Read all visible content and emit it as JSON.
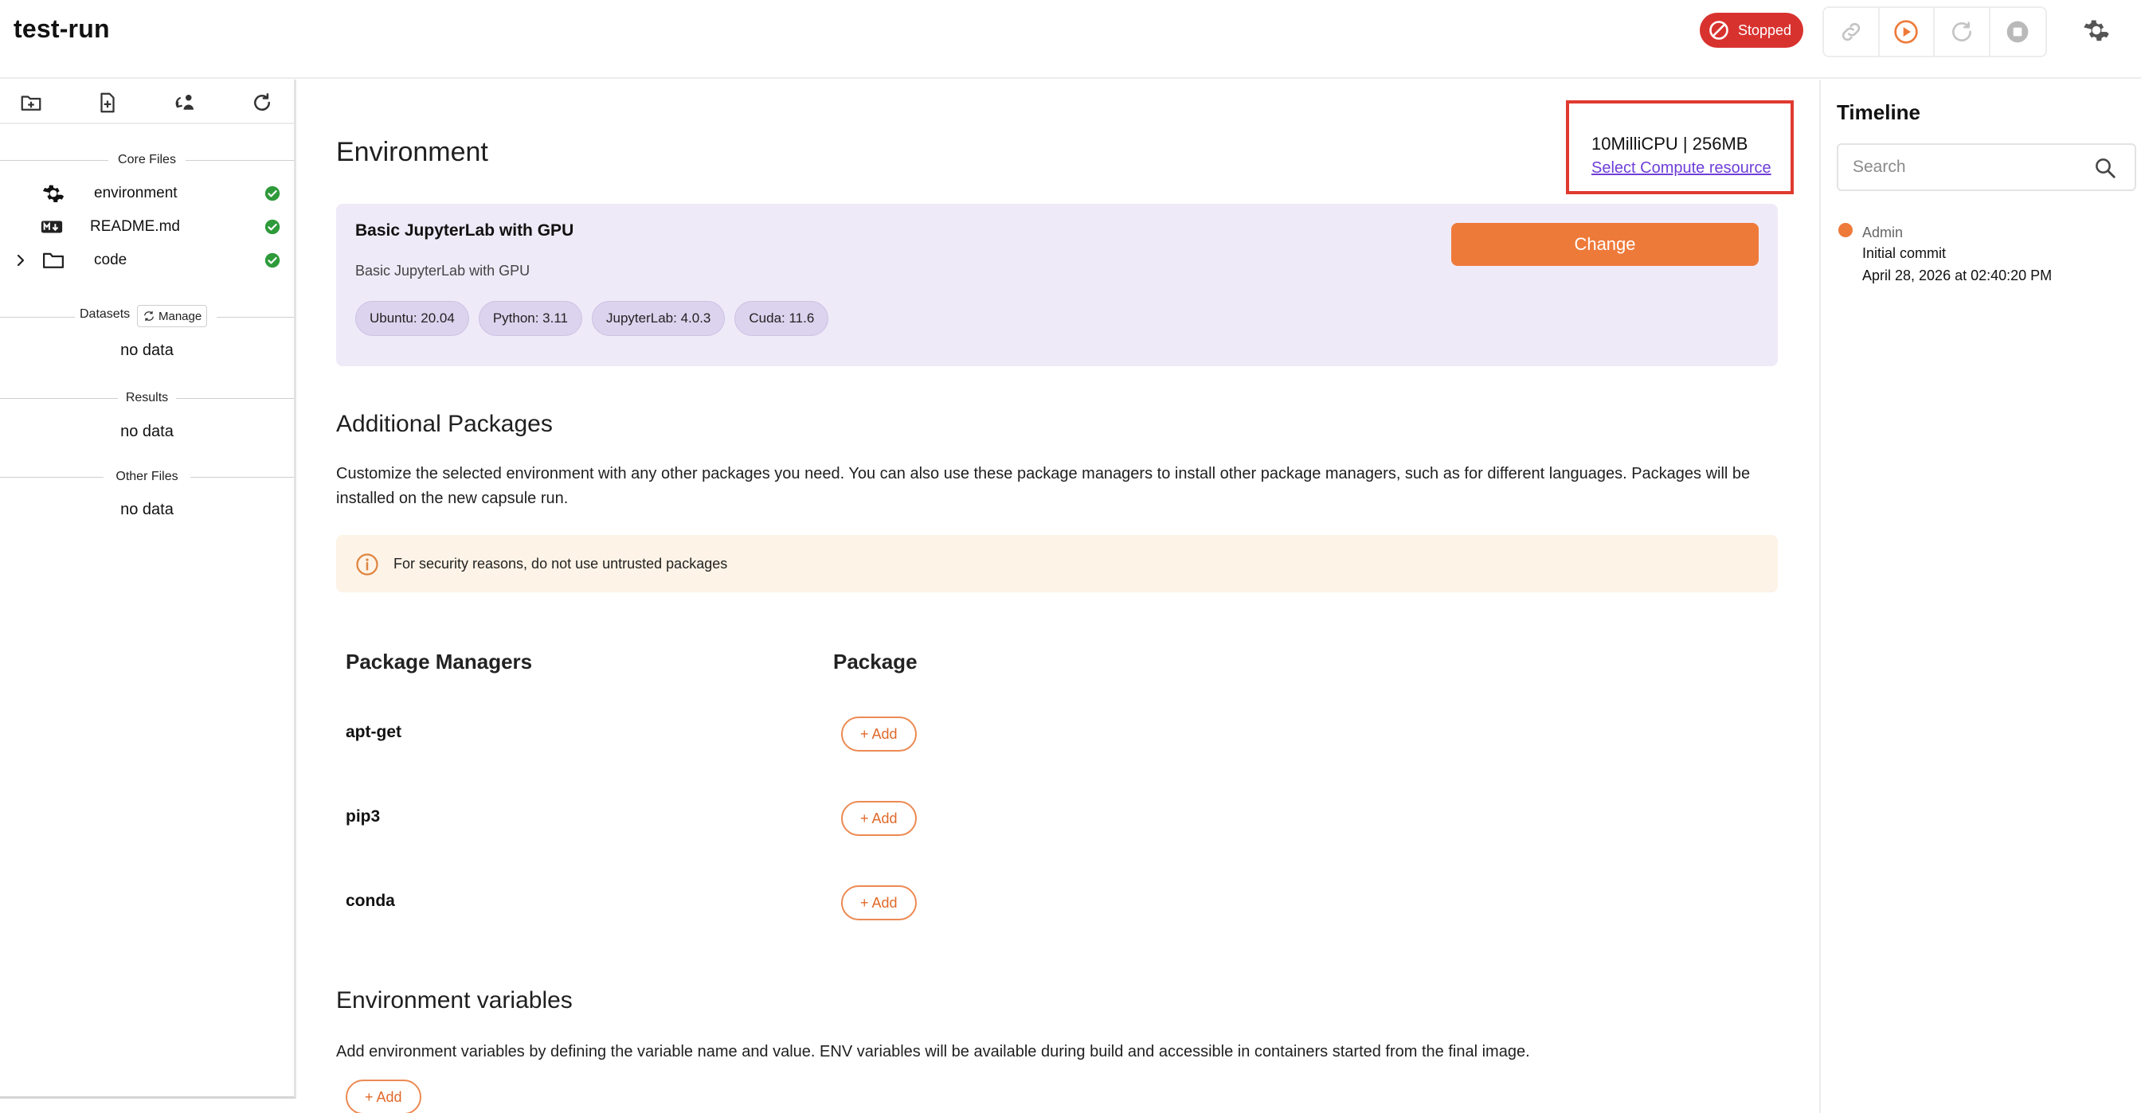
{
  "app": {
    "title": "test-run"
  },
  "header": {
    "status_label": "Stopped",
    "toolbar_icons": [
      "link-icon",
      "play-icon",
      "restart-icon",
      "stop-icon"
    ],
    "settings_icon": "gear-icon"
  },
  "sidebar": {
    "tool_icons": [
      "new-folder-icon",
      "new-file-icon",
      "version-control-icon",
      "refresh-icon"
    ],
    "core_files_title": "Core Files",
    "core_files": [
      {
        "name": "environment",
        "icon": "gear-icon",
        "status": "check-icon"
      },
      {
        "name": "README.md",
        "icon": "markdown-icon",
        "status": "check-icon"
      },
      {
        "name": "code",
        "icon": "folder-icon",
        "status": "check-icon",
        "expandable": true
      }
    ],
    "datasets_title": "Datasets",
    "datasets_manage_label": "Manage",
    "datasets_empty": "no data",
    "results_title": "Results",
    "results_empty": "no data",
    "other_files_title": "Other Files",
    "other_files_empty": "no data"
  },
  "main": {
    "environment_title": "Environment",
    "compute": {
      "value": "10MilliCPU | 256MB",
      "link_label": "Select Compute resource"
    },
    "env_card": {
      "name": "Basic JupyterLab with GPU",
      "description": "Basic JupyterLab with GPU",
      "change_label": "Change",
      "tags": [
        "Ubuntu: 20.04",
        "Python: 3.11",
        "JupyterLab: 4.0.3",
        "Cuda: 11.6"
      ]
    },
    "packages": {
      "title": "Additional Packages",
      "description": "Customize the selected environment with any other packages you need. You can also use these package managers to install other package managers, such as for different languages. Packages will be installed on the new capsule run.",
      "warning": "For security reasons, do not use untrusted packages",
      "col_managers": "Package Managers",
      "col_package": "Package",
      "managers": [
        {
          "name": "apt-get",
          "add_label": "+ Add"
        },
        {
          "name": "pip3",
          "add_label": "+ Add"
        },
        {
          "name": "conda",
          "add_label": "+ Add"
        }
      ]
    },
    "env_vars": {
      "title": "Environment variables",
      "description": "Add environment variables by defining the variable name and value. ENV variables will be available during build and accessible in containers started from the final image.",
      "add_label": "+ Add"
    }
  },
  "timeline": {
    "title": "Timeline",
    "search_placeholder": "Search",
    "entries": [
      {
        "author": "Admin",
        "message": "Initial commit",
        "date": "April 28, 2026 at 02:40:20 PM"
      }
    ]
  },
  "colors": {
    "accent": "#ee7a3a",
    "stopped": "#d8322f",
    "card_bg": "#efeaf8",
    "link": "#6f3fd8",
    "highlight_box": "#e0392f",
    "check": "#2e9a3a"
  }
}
